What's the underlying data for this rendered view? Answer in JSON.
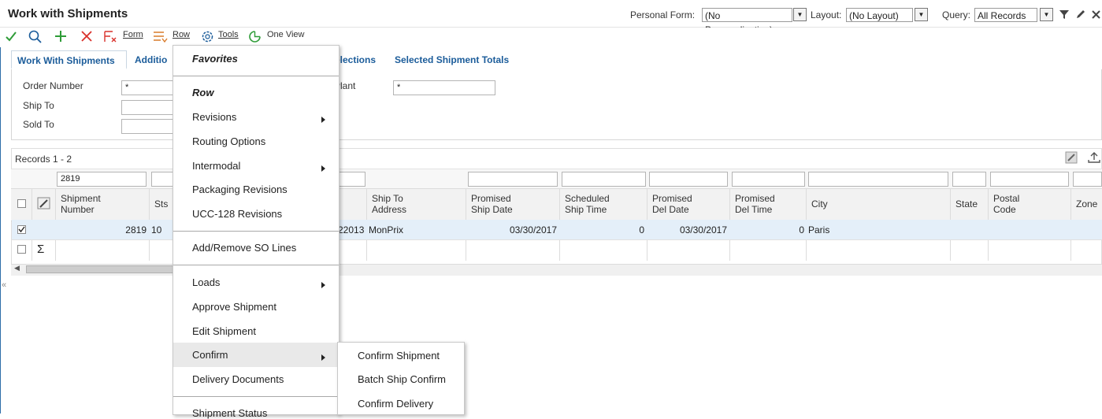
{
  "header": {
    "title": "Work with Shipments",
    "personal_form_label": "Personal Form:",
    "personal_form_value": "(No Personalization)",
    "layout_label": "Layout:",
    "layout_value": "(No Layout)",
    "query_label": "Query:",
    "query_value": "All Records"
  },
  "toolbar": {
    "form_label": "Form",
    "row_label": "Row",
    "tools_label": "Tools",
    "one_view_label": "One View"
  },
  "tabs": [
    "Work With Shipments",
    "Additio",
    "elections",
    "Selected Shipment Totals"
  ],
  "form": {
    "order_number_label": "Order Number",
    "order_number_value": "*",
    "ship_to_label": "Ship To",
    "sold_to_label": "Sold To",
    "plant_label": "Plant",
    "plant_value": "*"
  },
  "grid": {
    "records_label": "Records 1 - 2",
    "filter_shipment": "2819",
    "columns": [
      "Shipment Number",
      "Sts",
      "Ship To Address",
      "Promised Ship Date",
      "Scheduled Ship Time",
      "Promised Del Date",
      "Promised Del Time",
      "City",
      "State",
      "Postal Code",
      "Zone"
    ],
    "row": {
      "shipment_number": "2819",
      "sts": "10",
      "partial": "22013",
      "ship_to_address": "MonPrix",
      "promised_ship_date": "03/30/2017",
      "scheduled_ship_time": "0",
      "promised_del_date": "03/30/2017",
      "promised_del_time": "0",
      "city": "Paris"
    },
    "total_symbol": "Σ"
  },
  "menu": {
    "favorites": "Favorites",
    "row_header": "Row",
    "items": [
      "Revisions",
      "Routing Options",
      "Intermodal",
      "Packaging Revisions",
      "UCC-128 Revisions",
      "Add/Remove SO Lines",
      "Loads",
      "Approve Shipment",
      "Edit Shipment",
      "Confirm",
      "Delivery Documents",
      "Shipment Status"
    ]
  },
  "submenu": {
    "items": [
      "Confirm Shipment",
      "Batch Ship Confirm",
      "Confirm Delivery"
    ]
  },
  "colors": {
    "accent": "#1b5c9a",
    "selected_row": "#e4eff9",
    "check_green": "#2e9c37",
    "cancel_red": "#d9302a"
  }
}
